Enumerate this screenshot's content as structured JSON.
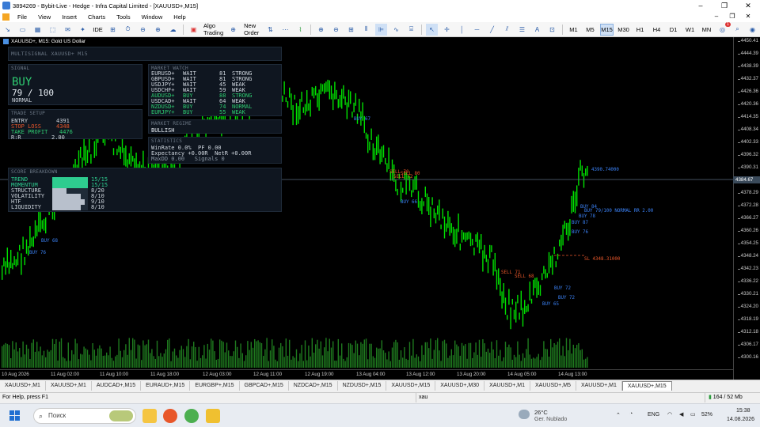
{
  "window": {
    "title": "3894269 - Bybit-Live - Hedge - Infra Capital Limited - [XAUUSD+,M15]",
    "minimize": "–",
    "maximize": "❐",
    "close": "✕"
  },
  "menu": [
    "File",
    "View",
    "Insert",
    "Charts",
    "Tools",
    "Window",
    "Help"
  ],
  "toolbar": {
    "ide": "IDE",
    "algo_trading": "Algo Trading",
    "new_order": "New Order",
    "timeframes": [
      "M1",
      "M5",
      "M15",
      "M30",
      "H1",
      "H4",
      "D1",
      "W1",
      "MN"
    ],
    "active_tf": "M15",
    "notifications": "1"
  },
  "chart": {
    "title": "XAUUSD+, M15: Gold US Dollar",
    "current_price": "4384.67",
    "price_labels": [
      "4450.41",
      "4444.39",
      "4438.39",
      "4432.37",
      "4426.36",
      "4420.36",
      "4414.35",
      "4408.34",
      "4402.33",
      "4396.32",
      "4390.31",
      "4384.31",
      "4378.29",
      "4372.28",
      "4366.27",
      "4360.26",
      "4354.25",
      "4348.24",
      "4342.23",
      "4336.22",
      "4330.21",
      "4324.20",
      "4318.19",
      "4312.18",
      "4306.17",
      "4300.16"
    ],
    "time_labels": [
      "10 Aug 2026",
      "11 Aug 02:00",
      "11 Aug 10:00",
      "11 Aug 18:00",
      "12 Aug 03:00",
      "12 Aug 11:00",
      "12 Aug 19:00",
      "13 Aug 04:00",
      "13 Aug 12:00",
      "13 Aug 20:00",
      "14 Aug 05:00",
      "14 Aug 13:00"
    ],
    "signals": [
      {
        "text": "BUY 67",
        "color": "#3b82f6"
      },
      {
        "text": "BUY 66",
        "color": "#3b82f6"
      },
      {
        "text": "BUY 68",
        "color": "#3b82f6"
      },
      {
        "text": "BUY 76",
        "color": "#3b82f6"
      },
      {
        "text": "SELL 70",
        "color": "#e8572a"
      },
      {
        "text": "SELL 72",
        "color": "#e8572a"
      },
      {
        "text": "SELL 80",
        "color": "#e8572a"
      },
      {
        "text": "SELL 71",
        "color": "#e8572a"
      },
      {
        "text": "SELL 68",
        "color": "#e8572a"
      },
      {
        "text": "BUY 72",
        "color": "#3b82f6"
      },
      {
        "text": "BUY 72",
        "color": "#3b82f6"
      },
      {
        "text": "BUY 65",
        "color": "#3b82f6"
      },
      {
        "text": "BUY 84",
        "color": "#3b82f6"
      },
      {
        "text": "BUY 78",
        "color": "#3b82f6"
      },
      {
        "text": "BUY 87",
        "color": "#3b82f6"
      },
      {
        "text": "BUY 76",
        "color": "#3b82f6"
      },
      {
        "text": "4390.74000",
        "color": "#3b82f6"
      },
      {
        "text": "BUY 79/100 NORMAL  RR 2.00",
        "color": "#3b82f6"
      },
      {
        "text": "SL 4348.31000",
        "color": "#e8572a"
      }
    ]
  },
  "multisignal": {
    "header": "MULTISIGNAL   XAUUSD+ M15"
  },
  "signal_panel": {
    "header": "SIGNAL",
    "direction": "BUY",
    "score": "79 / 100",
    "strength": "NORMAL"
  },
  "trade_setup": {
    "header": "TRADE SETUP",
    "entry_label": "ENTRY",
    "entry": "4391",
    "sl_label": "STOP LOSS",
    "sl": "4348",
    "tp_label": "TAKE PROFIT",
    "tp": "4476",
    "rr_label": "R:R",
    "rr": "2.00"
  },
  "market_watch": {
    "header": "MARKET WATCH",
    "rows": [
      {
        "sym": "EURUSD+",
        "sig": "WAIT",
        "score": "81",
        "tag": "STRONG",
        "color": "#cfd6de"
      },
      {
        "sym": "GBPUSD+",
        "sig": "WAIT",
        "score": "81",
        "tag": "STRONG",
        "color": "#cfd6de"
      },
      {
        "sym": "USDJPY+",
        "sig": "WAIT",
        "score": "45",
        "tag": "WEAK",
        "color": "#cfd6de"
      },
      {
        "sym": "USDCHF+",
        "sig": "WAIT",
        "score": "59",
        "tag": "WEAK",
        "color": "#cfd6de"
      },
      {
        "sym": "AUDUSD+",
        "sig": "BUY",
        "score": "88",
        "tag": "STRONG",
        "color": "#2ecc71"
      },
      {
        "sym": "USDCAD+",
        "sig": "WAIT",
        "score": "64",
        "tag": "WEAK",
        "color": "#cfd6de"
      },
      {
        "sym": "NZDUSD+",
        "sig": "BUY",
        "score": "74",
        "tag": "NORMAL",
        "color": "#2ecc71"
      },
      {
        "sym": "EURJPY+",
        "sig": "BUY",
        "score": "55",
        "tag": "WEAK",
        "color": "#2ecc71"
      }
    ]
  },
  "market_regime": {
    "header": "MARKET REGIME",
    "value": "BULLISH"
  },
  "statistics": {
    "header": "STATISTICS",
    "line1": "WinRate 0.0%  PF 0.00",
    "line2": "Expectancy +0.00R  NetR +0.00R",
    "line3": "MaxDD 0.00   Signals 0"
  },
  "score_breakdown": {
    "header": "SCORE BREAKDOWN",
    "rows": [
      {
        "label": "TREND",
        "value": "15/15",
        "fill": 1.0,
        "color": "#2ecc8f",
        "tcolor": "#2ecc8f"
      },
      {
        "label": "MOMENTUM",
        "value": "15/15",
        "fill": 1.0,
        "color": "#2ecc8f",
        "tcolor": "#2ecc8f"
      },
      {
        "label": "STRUCTURE",
        "value": "8/20",
        "fill": 0.4,
        "color": "#b8c0cc",
        "tcolor": "#cfd6de"
      },
      {
        "label": "VOLATILITY",
        "value": "8/10",
        "fill": 0.8,
        "color": "#b8c0cc",
        "tcolor": "#cfd6de"
      },
      {
        "label": "HTF",
        "value": "9/10",
        "fill": 0.9,
        "color": "#b8c0cc",
        "tcolor": "#cfd6de"
      },
      {
        "label": "LIQUIDITY",
        "value": "8/10",
        "fill": 0.8,
        "color": "#b8c0cc",
        "tcolor": "#cfd6de"
      }
    ]
  },
  "tabs": [
    "XAUUSD+,M1",
    "XAUUSD+,M1",
    "AUDCAD+,M15",
    "EURAUD+,M15",
    "EURGBP+,M15",
    "GBPCAD+,M15",
    "NZDCAD+,M15",
    "NZDUSD+,M15",
    "XAUUSD+,M15",
    "XAUUSD+,M30",
    "XAUUSD+,M1",
    "XAUUSD+,M5",
    "XAUUSD+,M1",
    "XAUUSD+,M15"
  ],
  "active_tab": 13,
  "status": {
    "help": "For Help, press F1",
    "symbol": "xau",
    "traffic": "164 / 52 Mb"
  },
  "taskbar": {
    "search": "Поиск",
    "weather_temp": "26°C",
    "weather_desc": "Ger. Nublado",
    "lang": "ENG",
    "battery": "52%",
    "time": "15:38",
    "date": "14.08.2026"
  }
}
